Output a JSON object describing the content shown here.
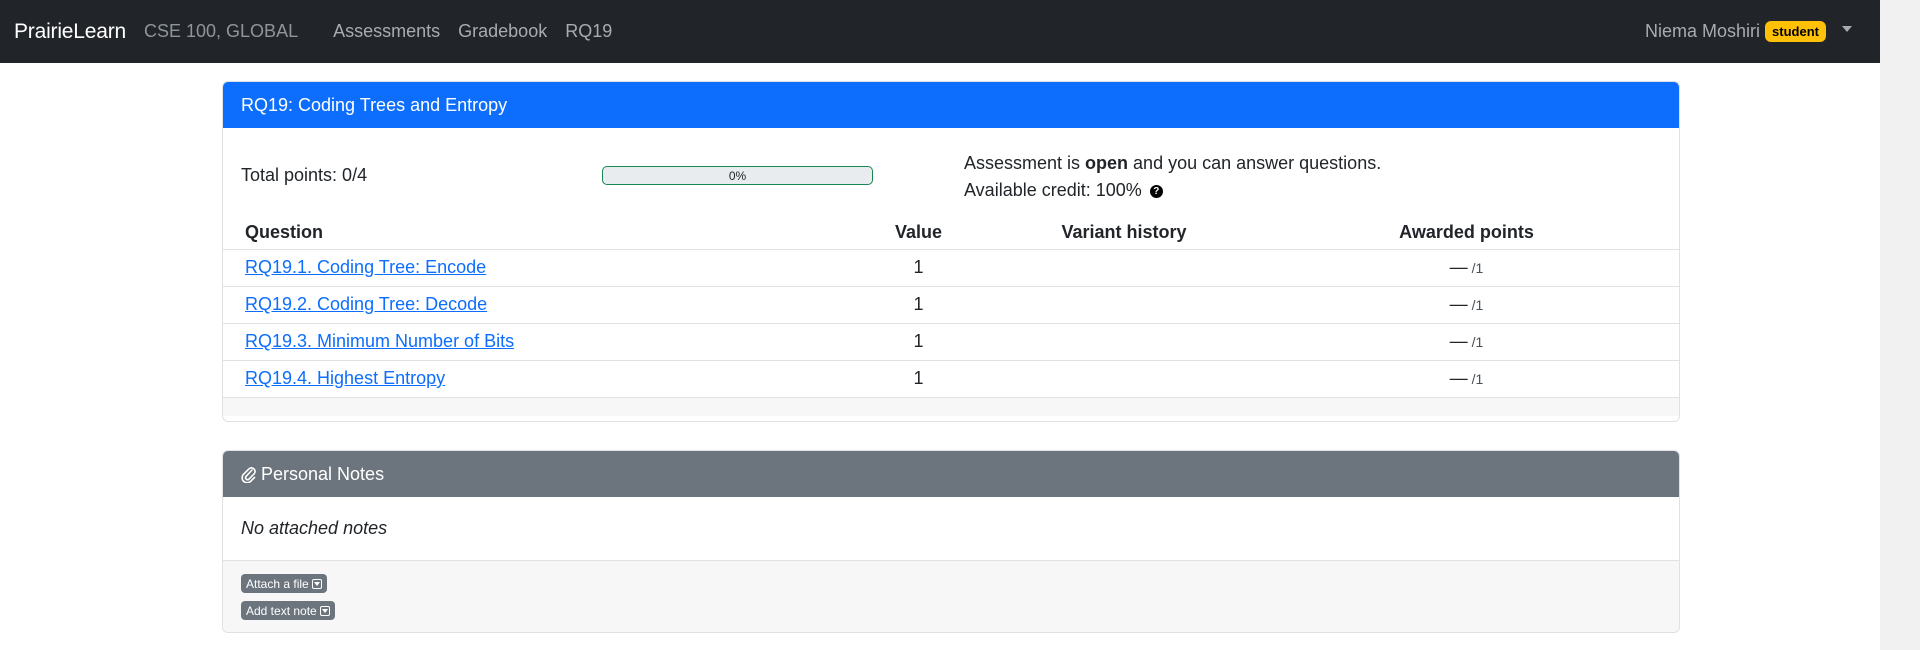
{
  "navbar": {
    "brand": "PrairieLearn",
    "course": "CSE 100, GLOBAL",
    "links": [
      "Assessments",
      "Gradebook",
      "RQ19"
    ],
    "user_name": "Niema Moshiri",
    "role_badge": "student"
  },
  "assessment": {
    "title": "RQ19: Coding Trees and Entropy",
    "total_points": "Total points: 0/4",
    "progress_label": "0%",
    "progress_value": 0,
    "status_prefix": "Assessment is ",
    "status_word": "open",
    "status_suffix": " and you can answer questions.",
    "credit": "Available credit: 100%",
    "columns": [
      "Question",
      "Value",
      "Variant history",
      "Awarded points"
    ],
    "questions": [
      {
        "label": "RQ19.1. Coding Tree: Encode",
        "value": "1",
        "awarded": "—",
        "out_of": "/1"
      },
      {
        "label": "RQ19.2. Coding Tree: Decode",
        "value": "1",
        "awarded": "—",
        "out_of": "/1"
      },
      {
        "label": "RQ19.3. Minimum Number of Bits",
        "value": "1",
        "awarded": "—",
        "out_of": "/1"
      },
      {
        "label": "RQ19.4. Highest Entropy",
        "value": "1",
        "awarded": "—",
        "out_of": "/1"
      }
    ]
  },
  "notes": {
    "title": "Personal Notes",
    "empty_text": "No attached notes",
    "attach_file_label": "Attach a file",
    "add_text_note_label": "Add text note"
  },
  "colors": {
    "navbar": "#212529",
    "primary": "#0d6efd",
    "secondary": "#6c757d",
    "badge": "#ffc107",
    "progress_border": "#198754"
  }
}
